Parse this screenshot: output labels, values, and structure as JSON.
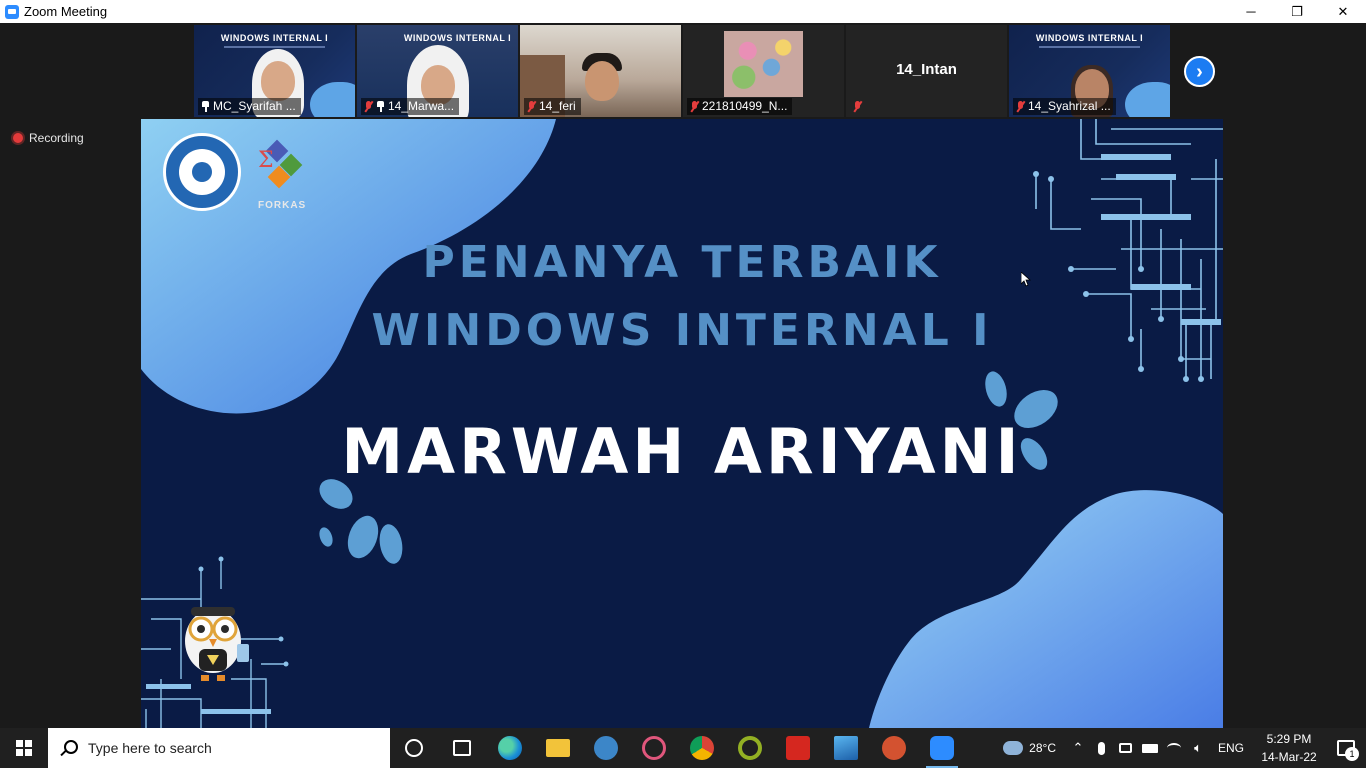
{
  "window": {
    "title": "Zoom Meeting",
    "controls": [
      "─",
      "❐",
      "✕"
    ]
  },
  "recording": {
    "label": "Recording"
  },
  "participants": [
    {
      "name": "MC_Syarifah ...",
      "muted": false,
      "pinned": true,
      "active": true
    },
    {
      "name": "14_Marwa...",
      "muted": true,
      "pinned": true,
      "active": false
    },
    {
      "name": "14_feri",
      "muted": true,
      "pinned": false,
      "active": false
    },
    {
      "name": "221810499_N...",
      "muted": true,
      "pinned": false,
      "active": false
    },
    {
      "name": "14_Intan",
      "muted": true,
      "pinned": false,
      "active": false,
      "video_off": true
    },
    {
      "name": "14_Syahrizal ...",
      "muted": true,
      "pinned": false,
      "active": false
    }
  ],
  "thumb_slide_title": "WINDOWS INTERNAL I",
  "next_button": "›",
  "slide": {
    "line1": "PENANYA TERBAIK",
    "line2": "WINDOWS INTERNAL I",
    "name": "MARWAH ARIYANI",
    "logo_text": "FORKAS",
    "colors": {
      "background": "#0a1b45",
      "accent": "#5590c6",
      "blob": "#6eb5ee"
    }
  },
  "taskbar": {
    "search_placeholder": "Type here to search",
    "apps": [
      "cortana-icon",
      "task-view-icon",
      "edge-icon",
      "file-explorer-icon",
      "calculator-icon",
      "snipping-tool-icon",
      "chrome-icon",
      "qgis-icon",
      "acrobat-icon",
      "photos-icon",
      "powerpoint-icon",
      "zoom-icon"
    ],
    "weather": "28°C",
    "language": "ENG",
    "time": "5:29 PM",
    "date": "14-Mar-22",
    "notification_count": "1"
  }
}
